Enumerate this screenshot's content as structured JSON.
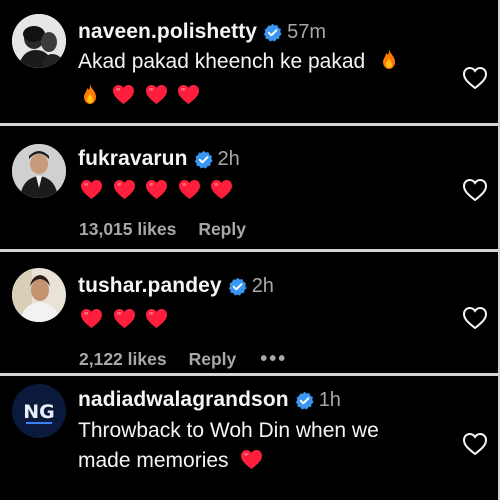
{
  "comments": [
    {
      "username": "naveen.polishetty",
      "time": "57m",
      "text": "Akad pakad kheench ke pakad",
      "hearts_line": [
        "fire-icon",
        "heart-icon",
        "heart-icon",
        "heart-icon"
      ],
      "avatar": "profile-photo"
    },
    {
      "username": "fukravarun",
      "time": "2h",
      "hearts_line": [
        "heart-icon",
        "heart-icon",
        "heart-icon",
        "heart-icon",
        "heart-icon"
      ],
      "likes": "13,015 likes",
      "reply": "Reply",
      "avatar": "profile-photo"
    },
    {
      "username": "tushar.pandey",
      "time": "2h",
      "hearts_line": [
        "heart-icon",
        "heart-icon",
        "heart-icon"
      ],
      "likes": "2,122 likes",
      "reply": "Reply",
      "more": "•••",
      "avatar": "profile-photo"
    },
    {
      "username": "nadiadwalagrandson",
      "time": "1h",
      "text_line1": "Throwback to Woh Din when we",
      "text_line2": "made memories",
      "avatar_logo_text": "NG",
      "avatar": "logo"
    }
  ],
  "colors": {
    "background": "#000000",
    "separator": "#d4d4d4",
    "username": "#f5f5f5",
    "secondary": "#a8a8a8",
    "heart": "#ff1f3d",
    "verified": "#3897f0"
  }
}
